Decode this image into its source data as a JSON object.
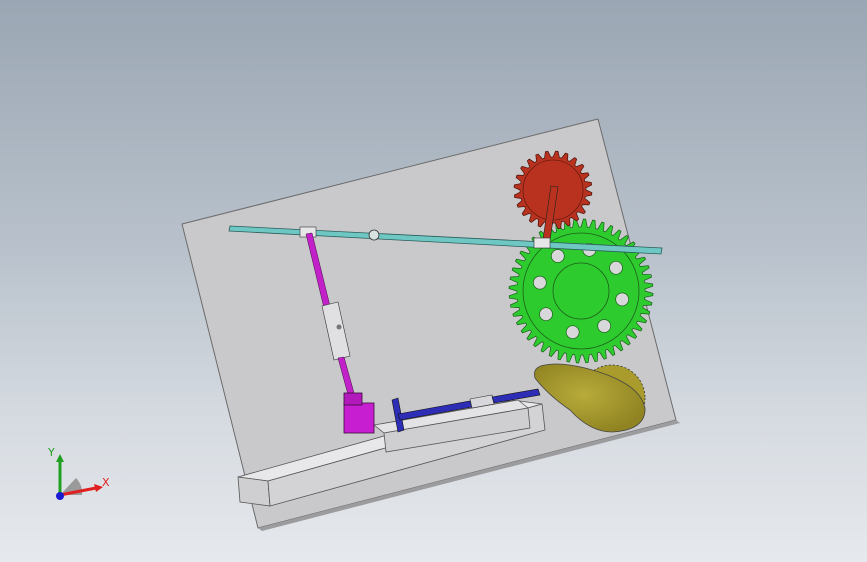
{
  "viewport": {
    "background_top": "#9aa6b3",
    "background_bottom": "#e6e9ed"
  },
  "model": {
    "components": [
      {
        "name": "base-plate",
        "color": "#c9c9cb"
      },
      {
        "name": "red-spur-gear",
        "color": "#b8321f",
        "teeth": 24
      },
      {
        "name": "green-spur-gear",
        "color": "#2ecb2e",
        "teeth": 48
      },
      {
        "name": "cyan-lever-arm",
        "color": "#6fc7c3"
      },
      {
        "name": "magenta-connecting-rod",
        "color": "#c220c8"
      },
      {
        "name": "purple-slider-block",
        "color": "#c81ed2"
      },
      {
        "name": "blue-pushrod",
        "color": "#2d2db5"
      },
      {
        "name": "olive-cam",
        "color": "#a99c2d"
      },
      {
        "name": "grey-guide-rail",
        "color": "#cfcfd1"
      },
      {
        "name": "bottom-base-block",
        "color": "#d3d3d5"
      }
    ]
  },
  "triad": {
    "x_label": "X",
    "y_label": "Y",
    "x_color": "#e02020",
    "y_color": "#20a020",
    "z_color": "#1a1ad0"
  }
}
